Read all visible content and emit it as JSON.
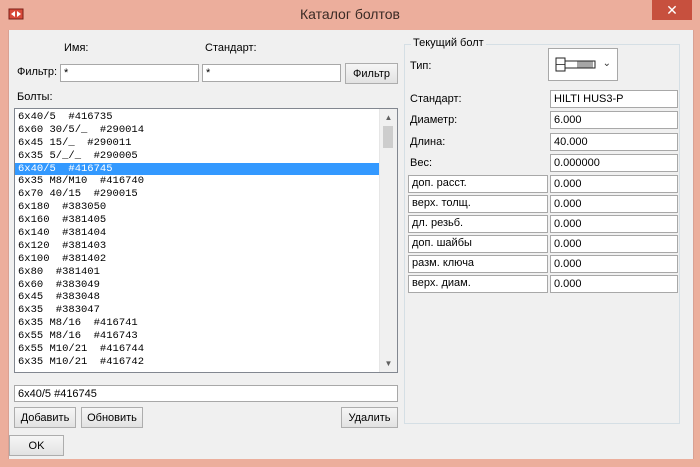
{
  "window": {
    "title": "Каталог болтов",
    "close_glyph": "✕"
  },
  "filter": {
    "name_header": "Имя:",
    "standard_header": "Стандарт:",
    "label": "Фильтр:",
    "name_value": "*",
    "standard_value": "*",
    "button_label": "Фильтр"
  },
  "bolts": {
    "label": "Болты:",
    "items": [
      "6x40/5  #416735",
      "6x60 30/5/_  #290014",
      "6x45 15/_  #290011",
      "6x35 5/_/_  #290005",
      "6x40/5  #416745",
      "6x35 M8/M10  #416740",
      "6x70 40/15  #290015",
      "6x180  #383050",
      "6x160  #381405",
      "6x140  #381404",
      "6x120  #381403",
      "6x100  #381402",
      "6x80  #381401",
      "6x60  #383049",
      "6x45  #383048",
      "6x35  #383047",
      "6x35 M8/16  #416741",
      "6x55 M8/16  #416743",
      "6x55 M10/21  #416744",
      "6x35 M10/21  #416742"
    ],
    "selected_index": 4,
    "current_text": "6x40/5 #416745"
  },
  "buttons": {
    "add": "Добавить",
    "refresh": "Обновить",
    "delete": "Удалить",
    "ok": "OK"
  },
  "current_bolt": {
    "title": "Текущий болт",
    "type_label": "Тип:",
    "type_icon": "bolt-icon",
    "standard_label": "Стандарт:",
    "standard_value": "HILTI HUS3-P",
    "diameter_label": "Диаметр:",
    "diameter_value": "6.000",
    "length_label": "Длина:",
    "length_value": "40.000",
    "weight_label": "Вес:",
    "weight_value": "0.000000",
    "params": [
      {
        "label": "доп. расст.",
        "value": "0.000"
      },
      {
        "label": "верх. толщ.",
        "value": "0.000"
      },
      {
        "label": "дл. резьб.",
        "value": "0.000"
      },
      {
        "label": "доп. шайбы",
        "value": "0.000"
      },
      {
        "label": "разм. ключа",
        "value": "0.000"
      },
      {
        "label": "верх. диам.",
        "value": "0.000"
      }
    ]
  },
  "colors": {
    "titlebar": "#ecae9c",
    "selection": "#3399ff",
    "close": "#c7503e"
  }
}
